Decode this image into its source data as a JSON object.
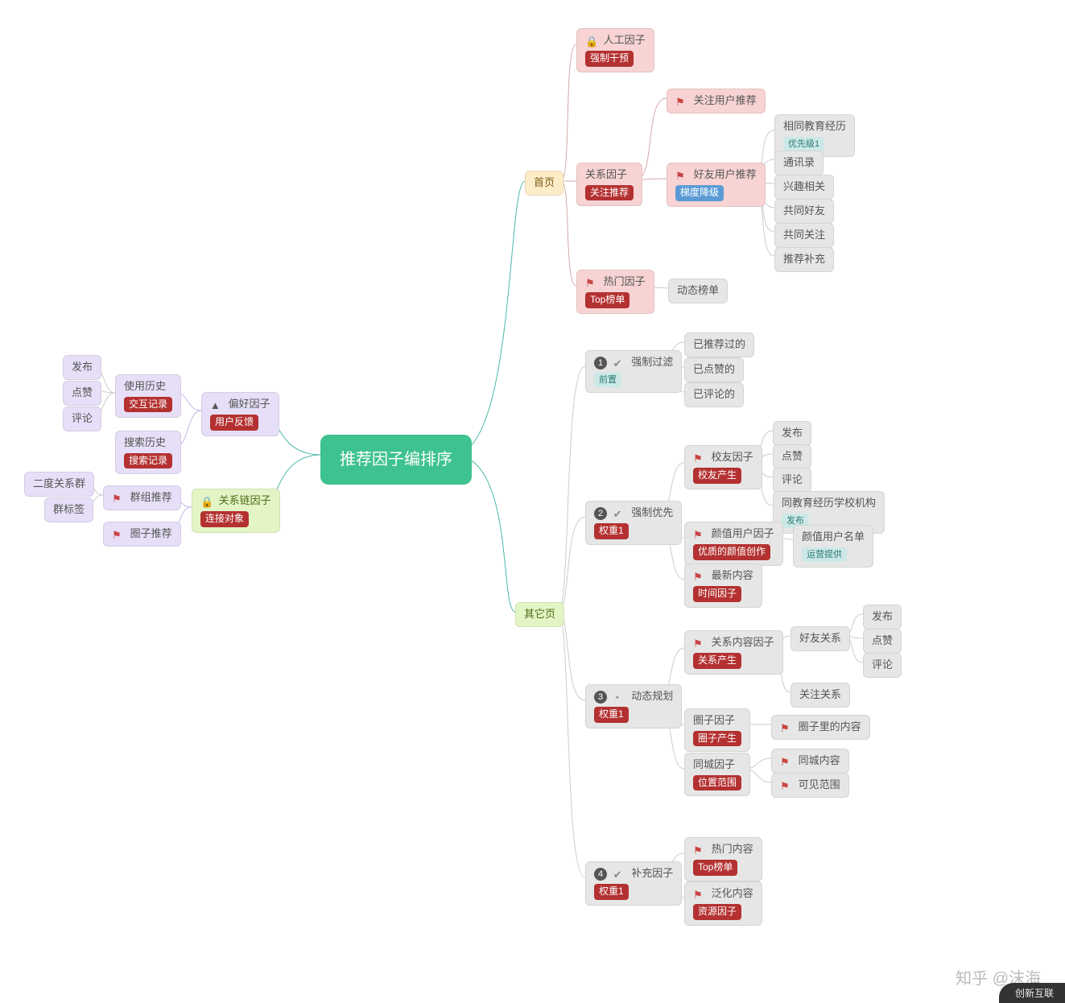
{
  "root": {
    "title": "推荐因子编排序"
  },
  "left": {
    "pref": {
      "label": "偏好因子",
      "badge": "用户反馈",
      "history": {
        "label": "使用历史",
        "badge": "交互记录",
        "children": [
          "发布",
          "点赞",
          "评论"
        ]
      },
      "search": {
        "label": "搜索历史",
        "badge": "搜索记录"
      }
    },
    "rel": {
      "label": "关系链因子",
      "badge": "连接对象",
      "group": {
        "label": "群组推荐",
        "children": [
          "二度关系群",
          "群标签"
        ]
      },
      "circle": {
        "label": "圈子推荐"
      }
    }
  },
  "right": {
    "home": {
      "label": "首页",
      "manual": {
        "label": "人工因子",
        "badge": "强制干预"
      },
      "relation": {
        "label": "关系因子",
        "badge": "关注推荐",
        "follow": {
          "label": "关注用户推荐"
        },
        "friend": {
          "label": "好友用户推荐",
          "badge": "梯度降级",
          "edu": {
            "label": "相同教育经历",
            "badge": "优先级1"
          },
          "contacts": "通讯录",
          "interest": "兴趣相关",
          "mutualFriend": "共同好友",
          "mutualFollow": "共同关注",
          "supplement": "推荐补充"
        }
      },
      "hot": {
        "label": "热门因子",
        "badge": "Top榜单",
        "child": "动态榜单"
      }
    },
    "other": {
      "label": "其它页",
      "s1": {
        "num": "1",
        "label": "强制过滤",
        "badge": "前置",
        "children": [
          "已推荐过的",
          "已点赞的",
          "已评论的"
        ]
      },
      "s2": {
        "num": "2",
        "label": "强制优先",
        "badge": "权重1",
        "school": {
          "label": "校友因子",
          "badge": "校友产生",
          "children": [
            "发布",
            "点赞",
            "评论"
          ],
          "edu": {
            "label": "同教育经历学校机构",
            "badge": "发布"
          }
        },
        "value": {
          "label": "颜值用户因子",
          "badge": "优质的颜值创作",
          "child": {
            "label": "颜值用户名单",
            "badge": "运营提供"
          }
        },
        "newest": {
          "label": "最新内容",
          "badge": "时间因子"
        }
      },
      "s3": {
        "num": "3",
        "label": "动态规划",
        "badge": "权重1",
        "relContent": {
          "label": "关系内容因子",
          "badge": "关系产生",
          "friendRel": {
            "label": "好友关系",
            "children": [
              "发布",
              "点赞",
              "评论"
            ]
          },
          "followRel": "关注关系"
        },
        "circle": {
          "label": "圈子因子",
          "badge": "圈子产生",
          "child": "圈子里的内容"
        },
        "city": {
          "label": "同城因子",
          "badge": "位置范围",
          "children": [
            "同城内容",
            "可见范围"
          ]
        }
      },
      "s4": {
        "num": "4",
        "label": "补充因子",
        "badge": "权重1",
        "hot": {
          "label": "热门内容",
          "badge": "Top榜单"
        },
        "general": {
          "label": "泛化内容",
          "badge": "资源因子"
        }
      }
    }
  },
  "watermark": "知乎 @沫海",
  "corner": "创新互联"
}
